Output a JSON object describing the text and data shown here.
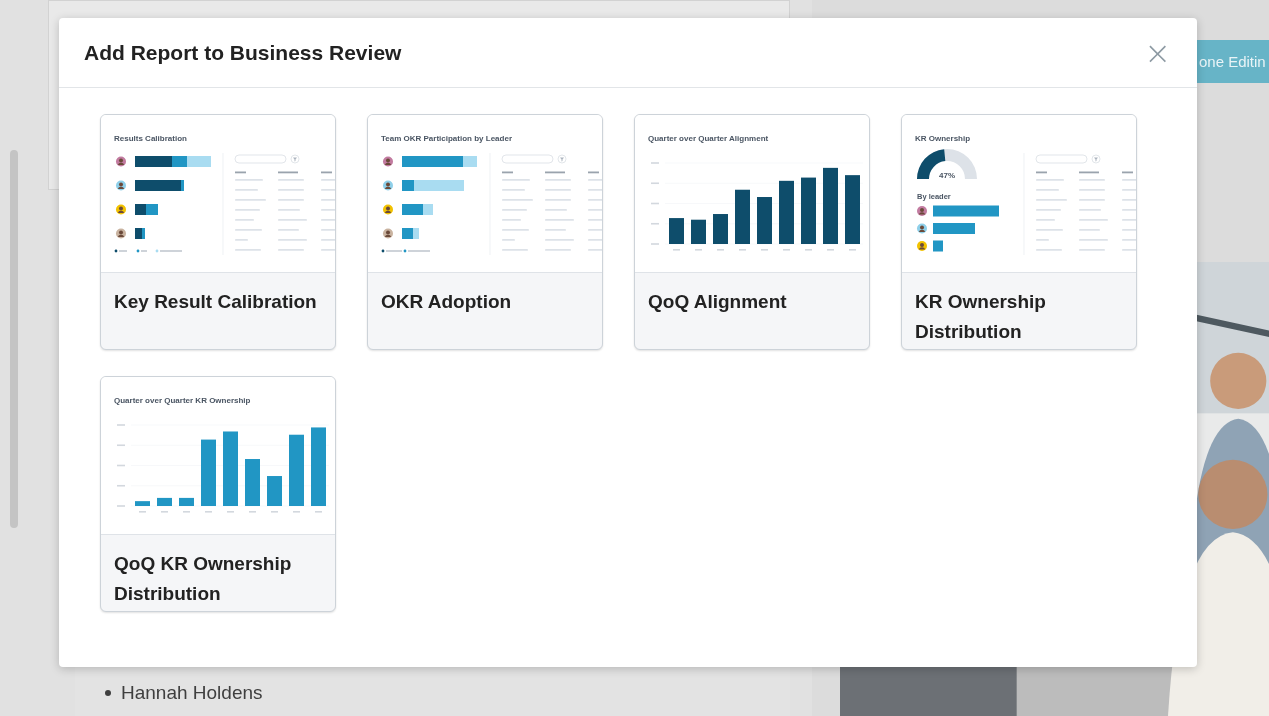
{
  "background": {
    "button": "one Editin",
    "list_items": [
      "Hannah Holdens"
    ]
  },
  "dialog": {
    "title": "Add Report to Business Review",
    "close": "×",
    "reports": [
      {
        "title": "Key Result Calibration",
        "preview": {
          "kind": "calibration",
          "heading": "Results Calibration"
        }
      },
      {
        "title": "OKR Adoption",
        "preview": {
          "kind": "participation",
          "heading": "Team OKR Participation by Leader"
        }
      },
      {
        "title": "QoQ Alignment",
        "preview": {
          "kind": "alignment_chart",
          "heading": "Quarter over Quarter Alignment"
        }
      },
      {
        "title": "KR Ownership Distribution",
        "preview": {
          "kind": "ownership",
          "heading": "KR Ownership",
          "gauge": "47%",
          "subheading": "By leader"
        }
      },
      {
        "title": "QoQ KR Ownership Distribution",
        "preview": {
          "kind": "kr_ownership_chart",
          "heading": "Quarter over Quarter KR Ownership"
        }
      }
    ]
  }
}
